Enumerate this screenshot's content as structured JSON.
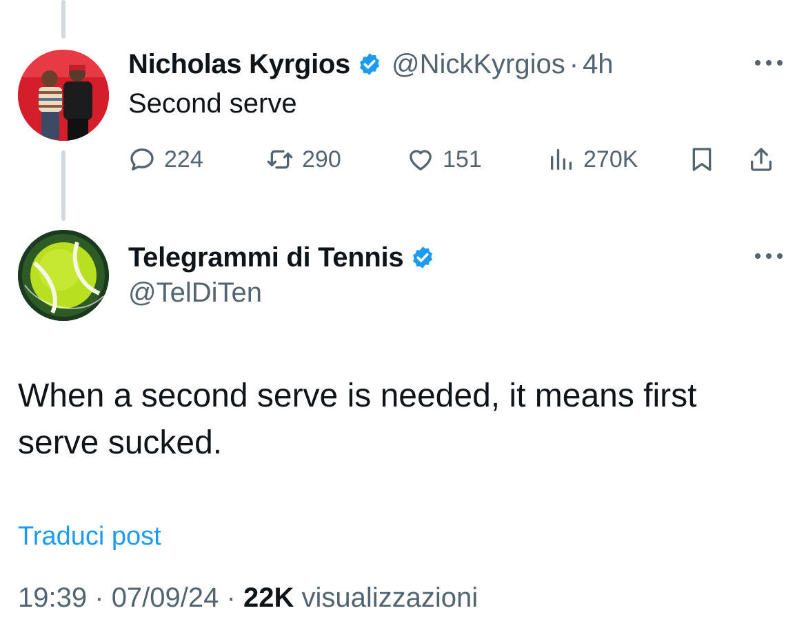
{
  "parent_tweet": {
    "display_name": "Nicholas Kyrgios",
    "handle": "@NickKyrgios",
    "separator": "·",
    "time": "4h",
    "text": "Second serve",
    "metrics": {
      "replies": "224",
      "reposts": "290",
      "likes": "151",
      "views": "270K"
    }
  },
  "main_tweet": {
    "display_name": "Telegrammi di Tennis",
    "handle": "@TelDiTen",
    "text": "When a second serve is needed, it means first serve sucked.",
    "translate_label": "Traduci post",
    "time": "19:39",
    "date": "07/09/24",
    "separator": "·",
    "views_count": "22K",
    "views_label": "visualizzazioni"
  },
  "colors": {
    "verified": "#1d9bf0",
    "link": "#1d9bf0",
    "secondary_text": "#536471",
    "primary_text": "#0f1419",
    "thread_line": "#cfd9de"
  },
  "icons": {
    "verified": "verified-badge-icon",
    "more": "more-horizontal-icon",
    "reply": "reply-icon",
    "repost": "repost-icon",
    "like": "heart-icon",
    "views": "views-chart-icon",
    "bookmark": "bookmark-icon",
    "share": "share-icon"
  }
}
